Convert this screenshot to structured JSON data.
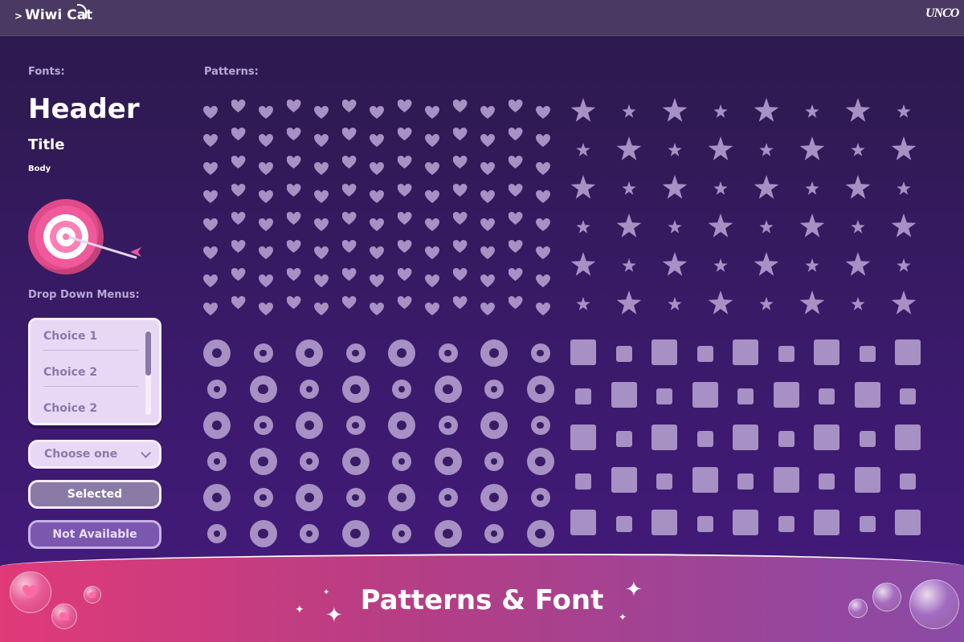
{
  "topbar": {
    "logo_text": "Wiwi Cat",
    "logo_chevron": ">",
    "brand_text": "UNCO"
  },
  "fonts": {
    "section_label": "Fonts:",
    "header_sample": "Header",
    "title_sample": "Title",
    "body_sample": "Body"
  },
  "patterns": {
    "section_label": "Patterns:",
    "sets": [
      "heart",
      "star",
      "flower",
      "gift"
    ]
  },
  "dropdowns": {
    "section_label": "Drop Down Menus:",
    "list_items": [
      "Choice 1",
      "Choice 2",
      "Choice 2"
    ],
    "select_placeholder": "Choose one",
    "selected_label": "Selected",
    "not_available_label": "Not Available"
  },
  "footer": {
    "title": "Patterns & Font"
  },
  "colors": {
    "pattern_glyph": "#a690c4",
    "accent_pink": "#e03a78",
    "panel_light": "#e8d8f5"
  }
}
